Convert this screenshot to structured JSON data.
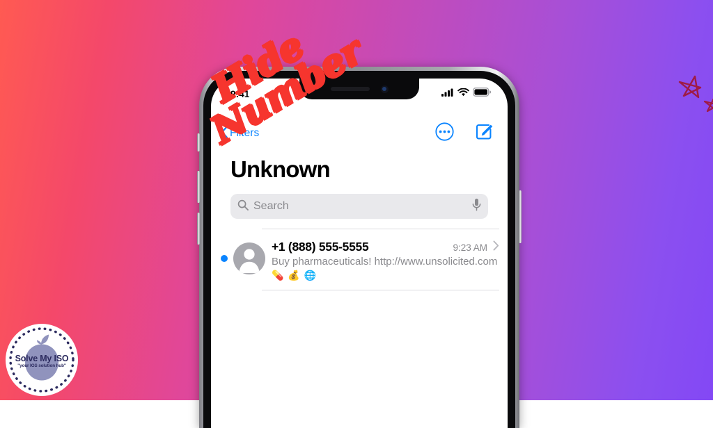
{
  "background": {
    "gradient_from": "#ff5a52",
    "gradient_mid": "#c44bb8",
    "gradient_to": "#8348f5"
  },
  "watermark": {
    "line1": "Hide",
    "line2": "Number",
    "color": "#f6352e"
  },
  "logo": {
    "brand": "Solve My ISO",
    "tagline": "\"your IOS solution hub\"",
    "brand_color": "#2b2a5e",
    "apple_icon": "apple-logo-icon"
  },
  "decoration": {
    "stars_icon": "star-outline-icon",
    "stars_color": "#9e1b46"
  },
  "phone": {
    "status_bar": {
      "time": "9:41",
      "cellular_icon": "cellular-signal-icon",
      "wifi_icon": "wifi-icon",
      "battery_icon": "battery-full-icon"
    },
    "nav": {
      "back_icon": "chevron-left-icon",
      "filters_label": "Filters",
      "more_icon": "ellipsis-circle-icon",
      "compose_icon": "compose-icon",
      "accent_color": "#0a84ff"
    },
    "title": "Unknown",
    "search": {
      "search_icon": "search-icon",
      "placeholder": "Search",
      "mic_icon": "microphone-icon",
      "value": ""
    },
    "conversations": [
      {
        "unread": true,
        "avatar_icon": "person-placeholder-icon",
        "sender": "+1 (888) 555-5555",
        "time": "9:23 AM",
        "preview": "Buy pharmaceuticals! http://www.unsolicited.com",
        "emoji": "💊 💰 🌐",
        "disclosure_icon": "chevron-right-icon"
      }
    ]
  }
}
